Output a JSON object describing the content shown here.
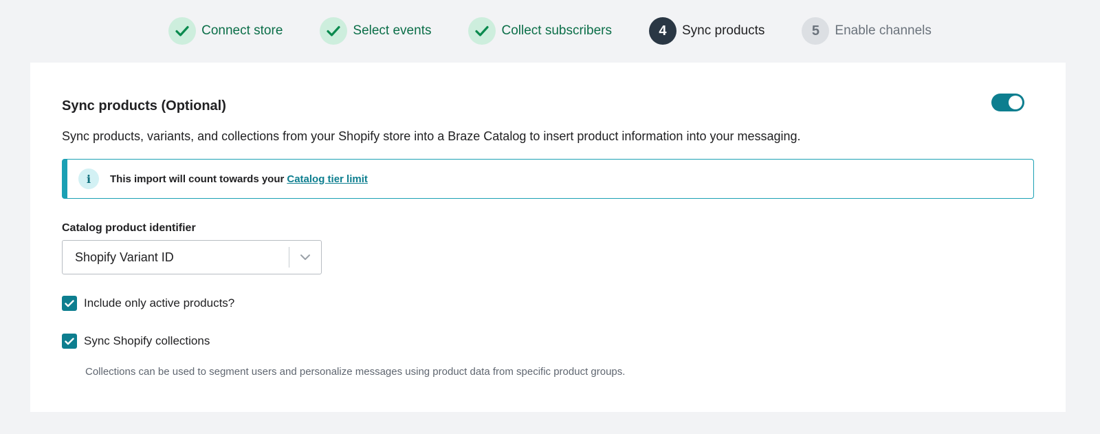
{
  "stepper": {
    "steps": [
      {
        "label": "Connect store",
        "status": "done",
        "marker": ""
      },
      {
        "label": "Select events",
        "status": "done",
        "marker": ""
      },
      {
        "label": "Collect subscribers",
        "status": "done",
        "marker": ""
      },
      {
        "label": "Sync products",
        "status": "active",
        "marker": "4"
      },
      {
        "label": "Enable channels",
        "status": "pending",
        "marker": "5"
      }
    ]
  },
  "section": {
    "title": "Sync products (Optional)",
    "toggle_on": true,
    "description": "Sync products, variants, and collections from your Shopify store into a Braze Catalog to insert product information into your messaging."
  },
  "banner": {
    "icon": "info-icon",
    "icon_glyph": "i",
    "text": "This import will count towards your",
    "link_label": "Catalog tier limit"
  },
  "identifier": {
    "label": "Catalog product identifier",
    "selected": "Shopify Variant ID"
  },
  "options": {
    "active_only": {
      "label": "Include only active products?",
      "checked": true
    },
    "collections": {
      "label": "Sync Shopify collections",
      "checked": true,
      "help": "Collections can be used to segment users and personalize messages using product data from specific product groups."
    }
  },
  "colors": {
    "accent": "#0d7e8f",
    "done_bg": "#cdeedd",
    "done_text": "#0b6e48",
    "active_bg": "#2a3744",
    "banner_border": "#1aa0b4"
  }
}
